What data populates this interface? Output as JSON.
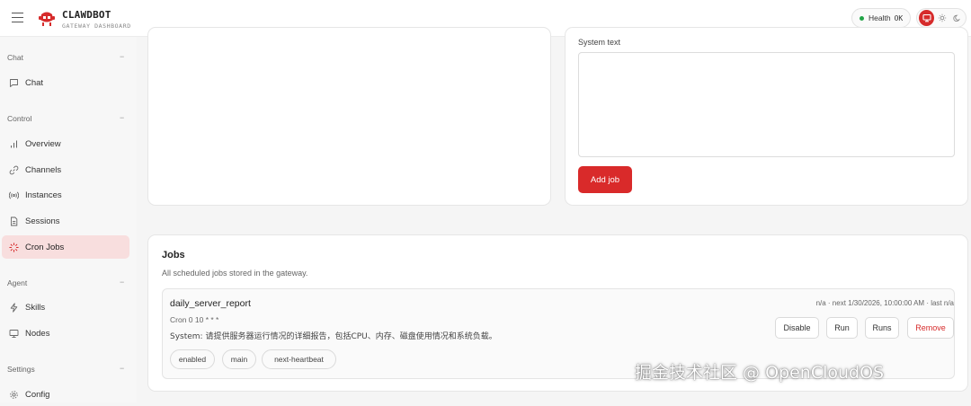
{
  "app": {
    "title": "CLAWDBOT",
    "subtitle": "GATEWAY DASHBOARD",
    "accent_color": "#d92a2a"
  },
  "header": {
    "health_label": "Health",
    "health_value": "OK",
    "health_color": "#22a447",
    "theme_icons": [
      "monitor-icon",
      "sun-icon",
      "moon-icon"
    ]
  },
  "sidebar": {
    "groups": [
      {
        "label": "Chat",
        "collapse": "−",
        "items": [
          {
            "label": "Chat",
            "icon": "chat-icon"
          }
        ]
      },
      {
        "label": "Control",
        "collapse": "−",
        "items": [
          {
            "label": "Overview",
            "icon": "bar-chart-icon"
          },
          {
            "label": "Channels",
            "icon": "link-icon"
          },
          {
            "label": "Instances",
            "icon": "radio-icon"
          },
          {
            "label": "Sessions",
            "icon": "document-icon"
          },
          {
            "label": "Cron Jobs",
            "icon": "loader-icon",
            "active": true
          }
        ]
      },
      {
        "label": "Agent",
        "collapse": "−",
        "items": [
          {
            "label": "Skills",
            "icon": "lightning-icon"
          },
          {
            "label": "Nodes",
            "icon": "monitor-icon"
          }
        ]
      },
      {
        "label": "Settings",
        "collapse": "−",
        "items": [
          {
            "label": "Config",
            "icon": "gear-icon"
          }
        ]
      }
    ]
  },
  "form": {
    "system_text_label": "System text",
    "system_text_value": "",
    "add_job_label": "Add job"
  },
  "jobs": {
    "title": "Jobs",
    "subtitle": "All scheduled jobs stored in the gateway.",
    "items": [
      {
        "name": "daily_server_report",
        "meta": "n/a · next 1/30/2026, 10:00:00 AM · last n/a",
        "cron": "Cron 0 10 * * *",
        "system": "System: 请提供服务器运行情况的详细报告，包括CPU、内存、磁盘使用情况和系统负载。",
        "chips": [
          "enabled",
          "main",
          "next-heartbeat"
        ],
        "actions": {
          "disable": "Disable",
          "run": "Run",
          "runs": "Runs",
          "remove": "Remove"
        }
      }
    ]
  },
  "watermark": "掘金技术社区 @ OpenCloudOS"
}
